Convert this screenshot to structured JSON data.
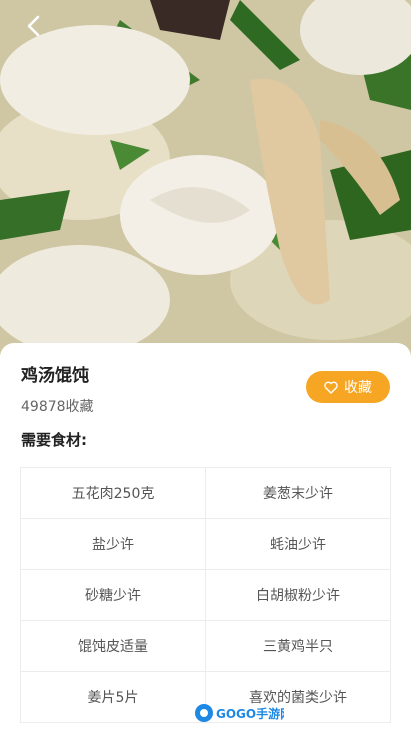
{
  "header": {
    "back_icon": "chevron-left-icon"
  },
  "recipe": {
    "title": "鸡汤馄饨",
    "favorites_count": "49878收藏",
    "favorite_label": "收藏",
    "favorite_icon": "heart-icon"
  },
  "ingredients": {
    "section_title": "需要食材:",
    "items": [
      "五花肉250克",
      "姜葱末少许",
      "盐少许",
      "蚝油少许",
      "砂糖少许",
      "白胡椒粉少许",
      "馄饨皮适量",
      "三黄鸡半只",
      "姜片5片",
      "喜欢的菌类少许"
    ]
  },
  "watermark": {
    "logo_text": "GOGO手游网"
  },
  "colors": {
    "accent": "#f6a623",
    "text_primary": "#222222",
    "text_secondary": "#666666"
  }
}
